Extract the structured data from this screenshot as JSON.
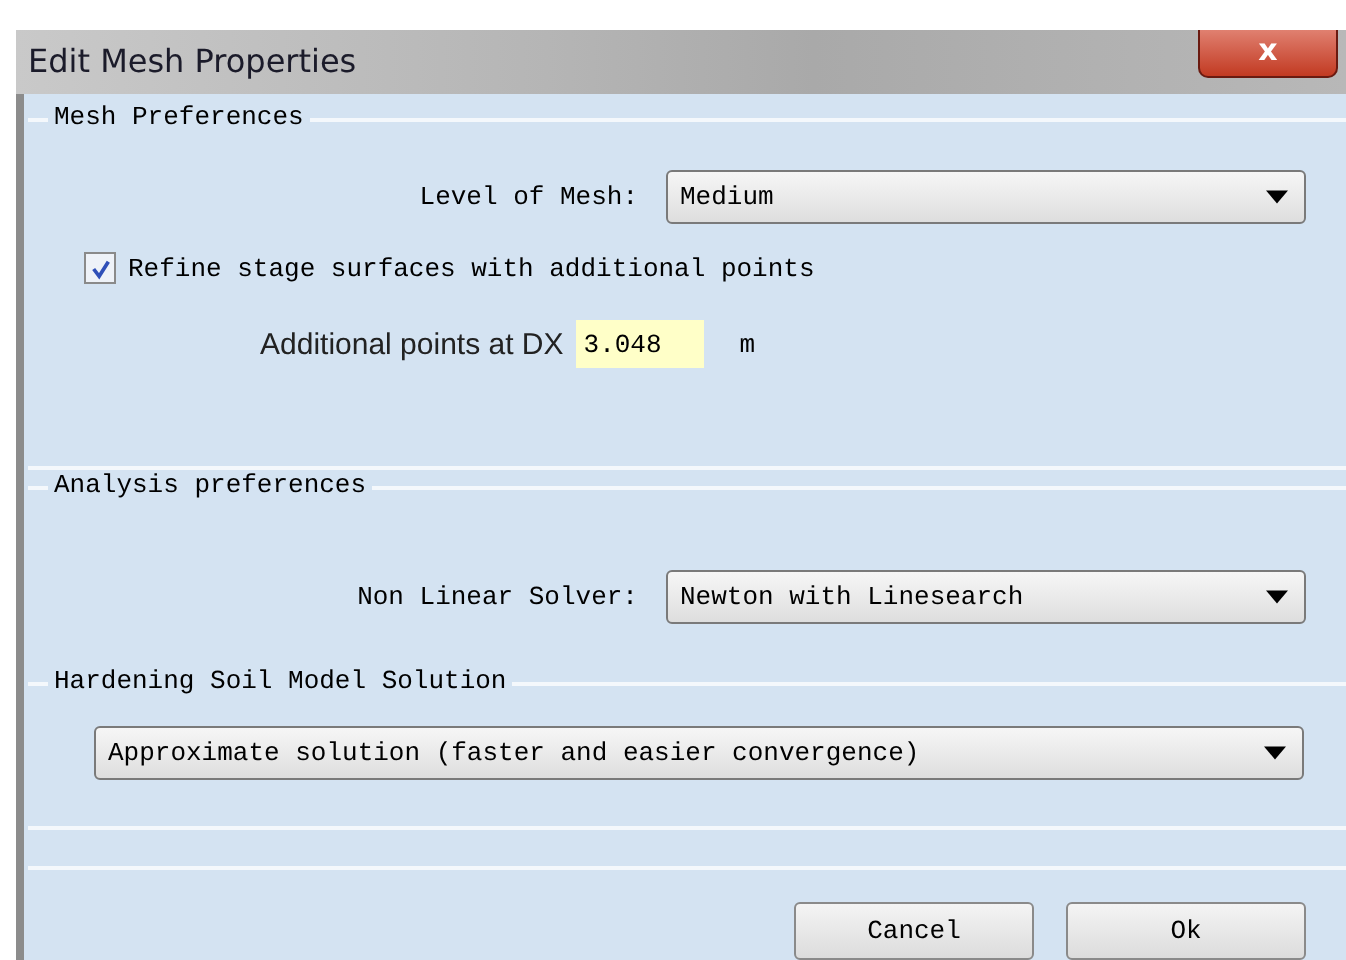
{
  "window": {
    "title": "Edit Mesh Properties",
    "close": "x"
  },
  "mesh_preferences": {
    "title": "Mesh Preferences",
    "level_label": "Level of Mesh:",
    "level_value": "Medium",
    "refine": {
      "label": "Refine stage surfaces with additional points",
      "checked": true
    },
    "dx_label": "Additional points at DX",
    "dx_value": "3.048",
    "dx_unit": "m"
  },
  "analysis_preferences": {
    "title": "Analysis preferences",
    "solver_label": "Non Linear Solver:",
    "solver_value": "Newton with Linesearch"
  },
  "hardening_soil": {
    "title": "Hardening Soil Model Solution",
    "solution_value": "Approximate solution (faster and easier convergence)"
  },
  "buttons": [
    "Cancel",
    "Ok"
  ]
}
